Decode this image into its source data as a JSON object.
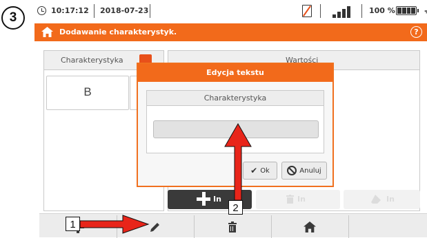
{
  "step": {
    "number": "3"
  },
  "status_bar": {
    "time": "10:17:12",
    "date": "2018-07-23",
    "battery_percent": "100 %",
    "icons": {
      "clock": "clock-icon",
      "sd": "sd-card-crossed-icon",
      "signal": "signal-bars-icon",
      "battery": "battery-icon",
      "power": "power-plug-icon"
    }
  },
  "title_bar": {
    "title": "Dodawanie charakterystyk.",
    "home_icon": "home-icon",
    "help_label": "?"
  },
  "characteristics_panel": {
    "header": "Charakterystyka",
    "items": [
      "B",
      ""
    ]
  },
  "values_panel": {
    "header": "Wartości"
  },
  "action_buttons": {
    "add_in_label": "In",
    "delete_in_label": "In",
    "edit_in_label": "In"
  },
  "dialog": {
    "title": "Edycja tekstu",
    "field_label": "Charakterystyka",
    "field_value": "",
    "ok_label": "Ok",
    "cancel_label": "Anuluj"
  },
  "toolbar": {
    "buttons": [
      "add-icon",
      "pencil-icon",
      "trash-icon",
      "home-icon"
    ]
  },
  "annotations": {
    "label_1": "1",
    "label_2": "2",
    "arrow_color": "#e8251a"
  },
  "colors": {
    "accent": "#f26a1b",
    "annotation": "#e8251a"
  }
}
